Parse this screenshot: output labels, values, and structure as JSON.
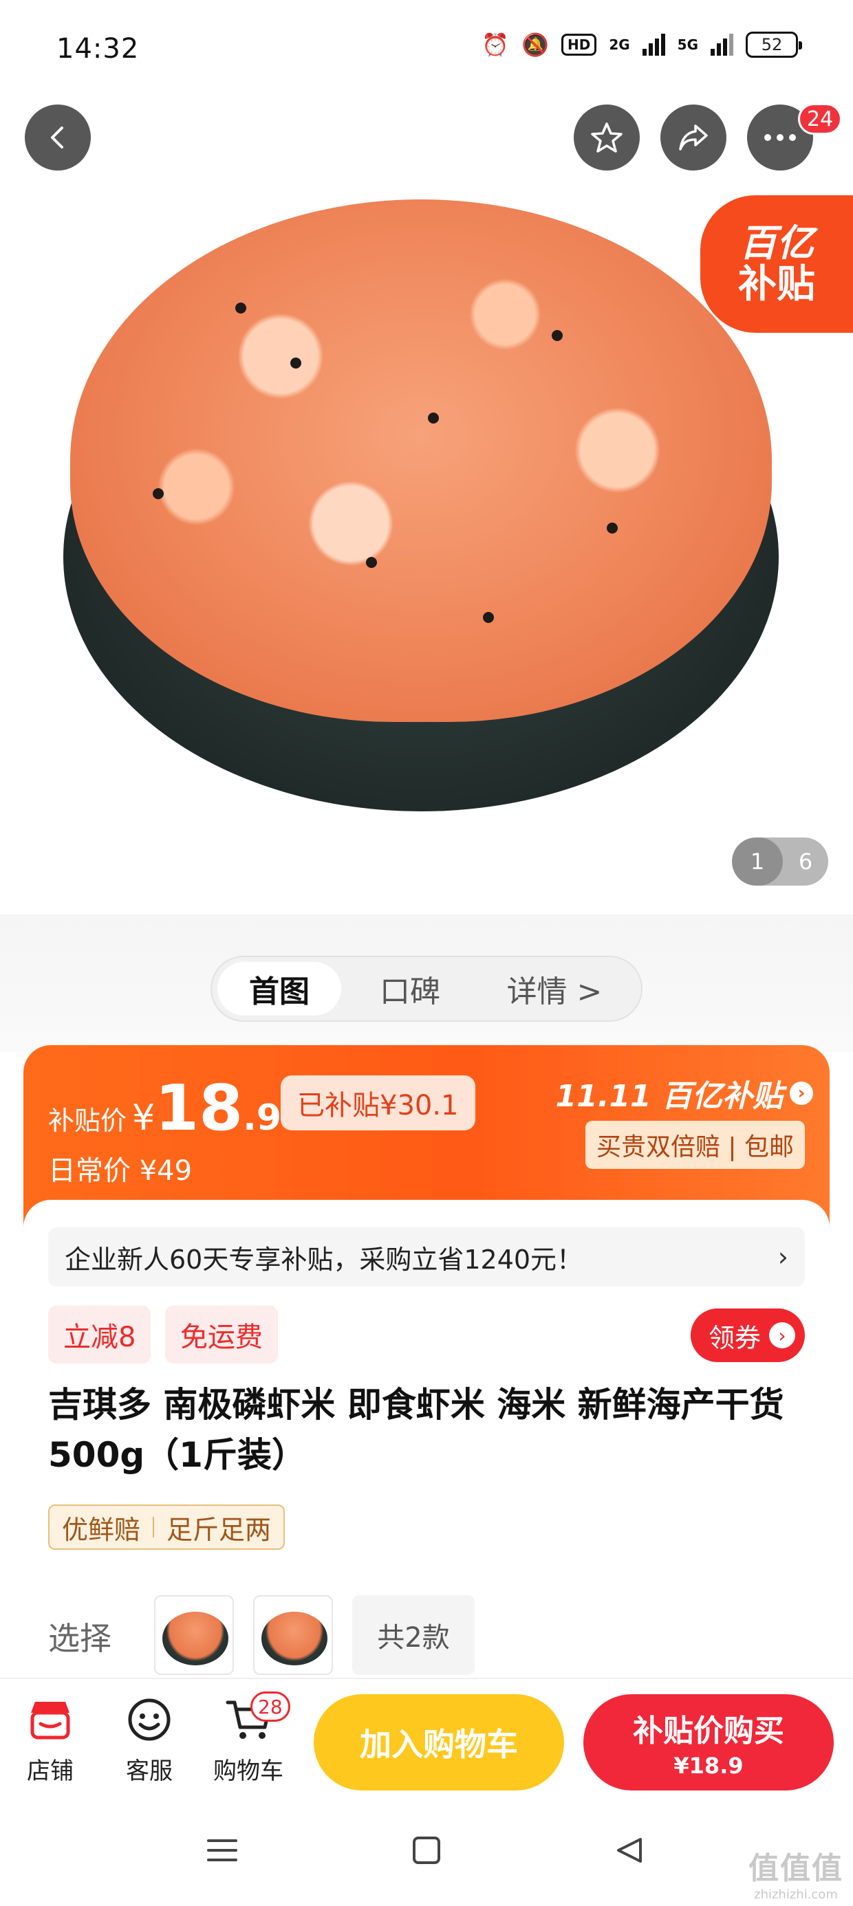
{
  "status_bar": {
    "time": "14:32",
    "hd": "HD",
    "net1": "2G",
    "net2": "5G",
    "battery": "52"
  },
  "header": {
    "back_icon": "back-arrow-icon",
    "favorite_icon": "star-icon",
    "share_icon": "share-icon",
    "more_icon": "more-icon",
    "more_badge": "24"
  },
  "hero": {
    "subsidy_tag_line1": "百亿",
    "subsidy_tag_line2": "补贴",
    "pager_current": "1",
    "pager_total": "6"
  },
  "tabs": [
    {
      "label": "首图"
    },
    {
      "label": "口碑"
    },
    {
      "label": "详情 >"
    }
  ],
  "price": {
    "label": "补贴价",
    "symbol": "¥",
    "integer": "18",
    "decimal": ".9",
    "saved": "已补贴¥30.1",
    "regular": "日常价 ¥49",
    "brand": "11.11 百亿补贴",
    "brand_arrow": "›",
    "guarantee": "买贵双倍赔 | 包邮"
  },
  "info": {
    "promo_text": "企业新人60天专享补贴，采购立省1240元！",
    "promo_chevron": "›",
    "tag1": "立减8",
    "tag2": "免运费",
    "coupon": "领券",
    "coupon_arrow": "›",
    "title": "吉琪多 南极磷虾米 即食虾米 海米 新鲜海产干货 500g（1斤装）",
    "feature1": "优鲜赔",
    "feature2": "足斤足两",
    "select_label": "选择",
    "variant_count": "共2款"
  },
  "actions": {
    "store": "店铺",
    "service": "客服",
    "cart": "购物车",
    "cart_badge": "28",
    "add_to_cart": "加入购物车",
    "buy_label": "补贴价购买",
    "buy_price": "¥18.9"
  },
  "watermark": {
    "line1": "值值值",
    "line2": "zhizhizhi.com"
  },
  "colors": {
    "accent_orange": "#ff5a16",
    "buy_red": "#f0283a",
    "cart_yellow": "#ffc81e",
    "badge_red": "#f0323c"
  }
}
